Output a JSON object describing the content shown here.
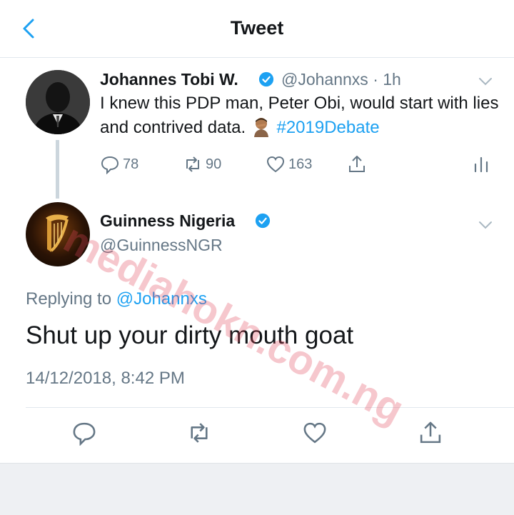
{
  "header": {
    "title": "Tweet"
  },
  "original_tweet": {
    "name": "Johannes Tobi W.",
    "handle": "@Johannxs",
    "time": "· 1h",
    "text": "I knew this PDP man, Peter Obi, would start with lies and contrived data.",
    "hashtag": "#2019Debate",
    "replies": "78",
    "retweets": "90",
    "likes": "163"
  },
  "reply_tweet": {
    "name": "Guinness Nigeria",
    "handle": "@GuinnessNGR",
    "replying_label": "Replying to",
    "replying_to": "@Johannxs",
    "text": "Shut up your dirty mouth goat",
    "timestamp": "14/12/2018, 8:42 PM"
  },
  "watermark": "mediahokn.com.ng",
  "colors": {
    "accent": "#1da1f2",
    "secondary_text": "#657786",
    "watermark": "#e0465a"
  }
}
